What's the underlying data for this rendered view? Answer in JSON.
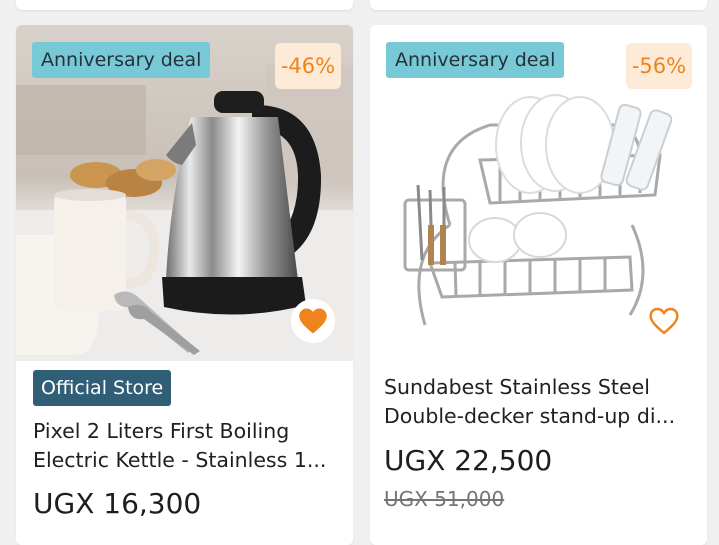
{
  "products": [
    {
      "badge": "Anniversary deal",
      "discount": "-46%",
      "store_badge": "Official Store",
      "title_line1": "Pixel 2 Liters First Boiling",
      "title_line2": "Electric Kettle - Stainless 1...",
      "price": "UGX 16,300",
      "favorite_icon": "heart-filled-icon",
      "image": "kettle-photo"
    },
    {
      "badge": "Anniversary deal",
      "discount": "-56%",
      "title_line1": "Sundabest Stainless Steel",
      "title_line2": "Double-decker stand-up di...",
      "price": "UGX 22,500",
      "old_price": "UGX 51,000",
      "favorite_icon": "heart-outline-icon",
      "image": "dish-rack-photo"
    }
  ],
  "colors": {
    "badge_bg": "#78c9d8",
    "discount_text": "#f0841c",
    "discount_bg": "#fdebd8",
    "official_store_bg": "#2f5e76",
    "heart": "#f0841c"
  }
}
